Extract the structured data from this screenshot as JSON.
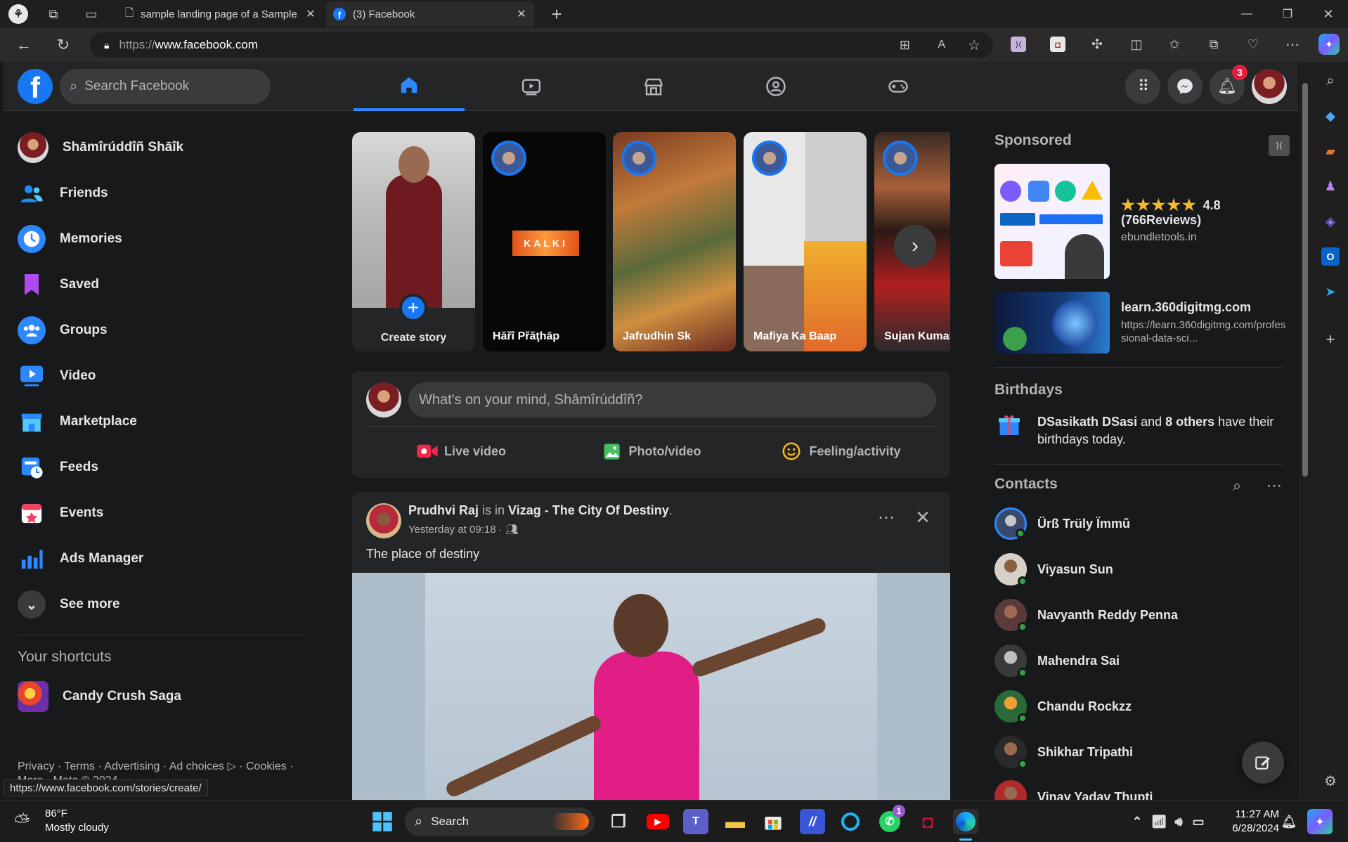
{
  "browser": {
    "tabs": [
      {
        "label": "sample landing page of a Sample"
      },
      {
        "label": "(3) Facebook"
      }
    ],
    "url_prefix": "https://",
    "url_domain": "www.facebook.com",
    "status_url": "https://www.facebook.com/stories/create/"
  },
  "fb": {
    "logo": "f",
    "search_placeholder": "Search Facebook",
    "notification_count": "3"
  },
  "sidebar": {
    "user": "Shāmîrúddîñ Shāîk",
    "items": [
      {
        "label": "Friends",
        "icon": "friends-icon"
      },
      {
        "label": "Memories",
        "icon": "memories-icon"
      },
      {
        "label": "Saved",
        "icon": "saved-icon"
      },
      {
        "label": "Groups",
        "icon": "groups-icon"
      },
      {
        "label": "Video",
        "icon": "video-icon"
      },
      {
        "label": "Marketplace",
        "icon": "marketplace-icon"
      },
      {
        "label": "Feeds",
        "icon": "feeds-icon"
      },
      {
        "label": "Events",
        "icon": "events-icon"
      },
      {
        "label": "Ads Manager",
        "icon": "ads-manager-icon"
      }
    ],
    "see_more": "See more",
    "shortcuts_title": "Your shortcuts",
    "shortcuts": [
      {
        "label": "Candy Crush Saga"
      }
    ],
    "footer": "Privacy · Terms · Advertising · Ad choices ▷ · Cookies ·",
    "footer2": "More · Meta © 2024"
  },
  "stories": {
    "create_label": "Create story",
    "items": [
      {
        "name": "Hăřî Přăţhāp"
      },
      {
        "name": "Jafrudhin Sk"
      },
      {
        "name": "Mafiya Ka Baap"
      },
      {
        "name": "Sujan Kumar"
      }
    ],
    "kalki_text": "KALKI"
  },
  "composer": {
    "placeholder": "What's on your mind, Shāmîrúddîñ?",
    "live": "Live video",
    "photo": "Photo/video",
    "feeling": "Feeling/activity"
  },
  "post": {
    "author": "Prudhvi Raj",
    "is_in": " is in ",
    "place": "Vizag - The City Of Destiny",
    "time": "Yesterday at 09:18 ·",
    "text": "The place of destiny"
  },
  "right": {
    "sponsored_title": "Sponsored",
    "ads": [
      {
        "rating": "4.8",
        "reviews": "(766Reviews)",
        "domain": "ebundletools.in",
        "stars": 5
      },
      {
        "title": "learn.360digitmg.com",
        "url": "https://learn.360digitmg.com/professional-data-sci..."
      }
    ],
    "birthdays_title": "Birthdays",
    "birthday_name": "DSasikath DSasi",
    "birthday_mid": " and ",
    "birthday_others": "8 others",
    "birthday_end": " have their birthdays today.",
    "contacts_title": "Contacts",
    "contacts": [
      "Ürß Trüly Ïmmû",
      "Viyasun Sun",
      "Navyanth Reddy Penna",
      "Mahendra Sai",
      "Chandu Rockzz",
      "Shikhar Tripathi",
      "Vinay Yadav Thupti"
    ]
  },
  "taskbar": {
    "temp": "86°F",
    "weather": "Mostly cloudy",
    "search": "Search",
    "time": "11:27 AM",
    "date": "6/28/2024",
    "whatsapp_badge": "1"
  }
}
